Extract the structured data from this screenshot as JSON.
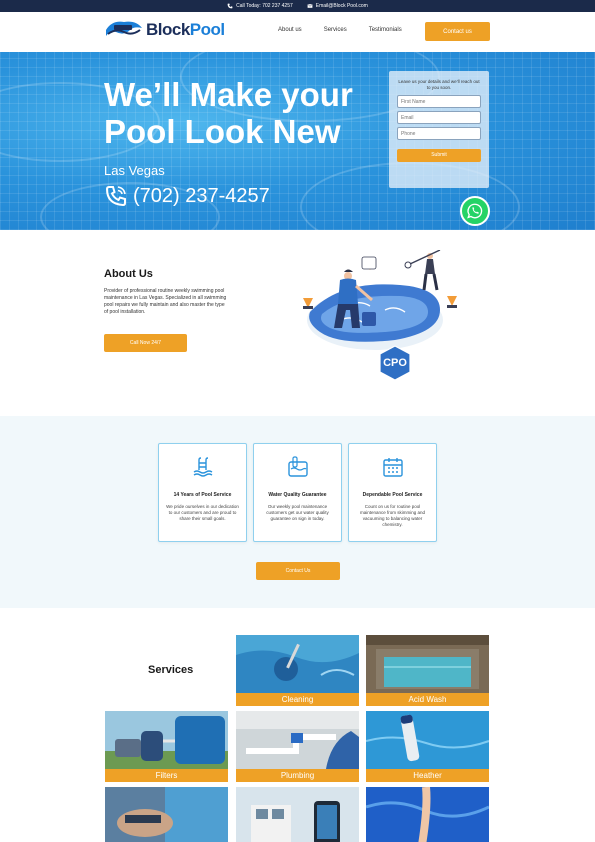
{
  "topbar": {
    "phone": "Call Today: 702 237 4257",
    "email": "Email@Block Pool.com"
  },
  "header": {
    "logo_prefix": "Block",
    "logo_suffix": "Pool",
    "nav": [
      "About us",
      "Services",
      "Testimonials"
    ],
    "contact_label": "Contact us"
  },
  "hero": {
    "title": "We’ll Make your Pool Look New",
    "city": "Las Vegas",
    "phone": "(702) 237-4257",
    "form": {
      "intro": "Leave us your details and we’ll reach out to you soon.",
      "placeholders": [
        "First Name",
        "Email",
        "Phone"
      ],
      "submit_label": "Submit"
    }
  },
  "about": {
    "title": "About Us",
    "text": "Provider of professional routine weekly swimming pool maintenance in Las Vegas. Specialized in all swimming pool repairs we fully maintain and also master the type of pool installation.",
    "button_label": "Call Now 24/7",
    "badge": "CPO"
  },
  "features": {
    "cards": [
      {
        "title": "14 Years of Pool Service",
        "desc": "We pride ourselves in our dedication to our customers and are proud to share their small goals.",
        "icon": "pool-ladder-icon"
      },
      {
        "title": "Water Quality Guarantee",
        "desc": "Our weekly pool maintenance customers get our water quality guarantee on sign in today.",
        "icon": "water-test-icon"
      },
      {
        "title": "Dependable Pool Service",
        "desc": "Count on us for routine pool maintenance from skimming and vacuuming to balancing water chemistry.",
        "icon": "calendar-icon"
      }
    ],
    "button_label": "Contact Us"
  },
  "services": {
    "title": "Services",
    "tiles": [
      "Cleaning",
      "Acid Wash",
      "Filters",
      "Plumbing",
      "Heather",
      "",
      "",
      ""
    ]
  },
  "colors": {
    "accent": "#eea126",
    "navy": "#1b2a4a",
    "brand_blue": "#1b7fd8"
  }
}
